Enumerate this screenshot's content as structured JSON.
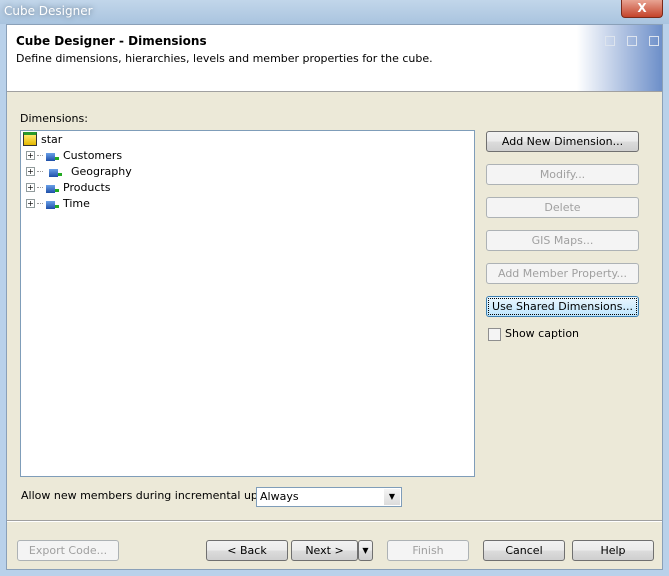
{
  "window": {
    "title": "Cube Designer",
    "close_label": "X"
  },
  "header": {
    "title": "Cube Designer - Dimensions",
    "subtitle": "Define dimensions, hierarchies, levels and member properties for the cube."
  },
  "dimensions_label": "Dimensions:",
  "tree": {
    "root": "star",
    "items": [
      "Customers",
      "Geography",
      "Products",
      "Time"
    ]
  },
  "buttons": {
    "add_new": "Add New Dimension...",
    "modify": "Modify...",
    "delete": "Delete",
    "gis_maps": "GIS Maps...",
    "add_member_property": "Add Member Property...",
    "use_shared": "Use Shared Dimensions..."
  },
  "show_caption": {
    "label": "Show caption",
    "checked": false
  },
  "incremental": {
    "label": "Allow new members during incremental update:",
    "value": "Always"
  },
  "footer": {
    "export": "Export Code...",
    "back": "< Back",
    "next": "Next >",
    "finish": "Finish",
    "cancel": "Cancel",
    "help": "Help"
  }
}
